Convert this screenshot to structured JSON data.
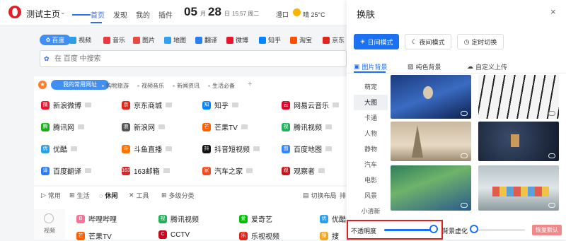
{
  "header": {
    "site_title": "测试主页",
    "nav": [
      "首页",
      "发现",
      "我的",
      "插件"
    ],
    "month": "05",
    "month_unit": "月",
    "day": "28",
    "day_unit": "日",
    "time_weekday": "15:57 周二",
    "city": "澧口",
    "weather": "晴 25°C"
  },
  "search": {
    "engines": [
      {
        "label": "百度",
        "color": "#3f8ff5"
      },
      {
        "label": "视频",
        "color": "#2b9fe8"
      },
      {
        "label": "音乐",
        "color": "#e8393f"
      },
      {
        "label": "图片",
        "color": "#e84a3f"
      },
      {
        "label": "地图",
        "color": "#31a0ee"
      },
      {
        "label": "翻译",
        "color": "#2b7df3"
      },
      {
        "label": "微博",
        "color": "#e6162d"
      },
      {
        "label": "知乎",
        "color": "#0084ff"
      },
      {
        "label": "淘宝",
        "color": "#ff5000"
      },
      {
        "label": "京东",
        "color": "#e1251b"
      }
    ],
    "placeholder": "在 百度 中搜索"
  },
  "links": {
    "tab_active": "我的常用网址",
    "categories": [
      "购物旅游",
      "视频音乐",
      "新闻资讯",
      "生活必备"
    ],
    "add": "+",
    "sites": [
      {
        "name": "新浪微博",
        "color": "#e6162d",
        "short": "微"
      },
      {
        "name": "京东商城",
        "color": "#e1251b",
        "short": "京"
      },
      {
        "name": "知乎",
        "color": "#0084ff",
        "short": "知"
      },
      {
        "name": "网易云音乐",
        "color": "#e60026",
        "short": "云"
      },
      {
        "name": "腾讯网",
        "color": "#1aad19",
        "short": "腾"
      },
      {
        "name": "新浪网",
        "color": "#555555",
        "short": "浪"
      },
      {
        "name": "芒果TV",
        "color": "#ff5f00",
        "short": "芒"
      },
      {
        "name": "腾讯视频",
        "color": "#20b15a",
        "short": "视"
      },
      {
        "name": "优酷",
        "color": "#2b9fe8",
        "short": "优"
      },
      {
        "name": "斗鱼直播",
        "color": "#ff7300",
        "short": "斗"
      },
      {
        "name": "抖音短视频",
        "color": "#111111",
        "short": "抖"
      },
      {
        "name": "百度地图",
        "color": "#3385ff",
        "short": "图"
      },
      {
        "name": "百度翻译",
        "color": "#2b7df3",
        "short": "译"
      },
      {
        "name": "163邮箱",
        "color": "#d8232a",
        "short": "163"
      },
      {
        "name": "汽车之家",
        "color": "#f24a1a",
        "short": "家"
      },
      {
        "name": "观察者",
        "color": "#c4161c",
        "short": "观"
      }
    ]
  },
  "bottom": {
    "tabs": [
      "常用",
      "生活",
      "休闲",
      "工具",
      "多级分类"
    ],
    "switch_layout": "切换布局",
    "more": "排",
    "side_label": "视频",
    "sites": [
      {
        "name": "哔哩哔哩",
        "color": "#fb7299",
        "short": "B"
      },
      {
        "name": "腾讯视频",
        "color": "#20b15a",
        "short": "视"
      },
      {
        "name": "爱奇艺",
        "color": "#00be06",
        "short": "爱"
      },
      {
        "name": "优酷",
        "color": "#2b9fe8",
        "short": "优"
      },
      {
        "name": "芒果TV",
        "color": "#ff5f00",
        "short": "芒"
      },
      {
        "name": "CCTV",
        "color": "#d0021b",
        "short": "C"
      },
      {
        "name": "乐视视频",
        "color": "#e1251b",
        "short": "乐"
      },
      {
        "name": "搜",
        "color": "#f5a623",
        "short": "搜"
      }
    ]
  },
  "skin": {
    "title": "换肤",
    "close": "×",
    "modes": [
      "日间模式",
      "夜间模式",
      "定时切换"
    ],
    "tabs": [
      "图片背景",
      "纯色背景",
      "自定义上传"
    ],
    "categories": [
      "萌宠",
      "大图",
      "卡通",
      "人物",
      "静物",
      "汽车",
      "电影",
      "风景",
      "小清新"
    ],
    "active_category": "大图",
    "opacity_label": "不透明度",
    "opacity_value": 0.95,
    "blur_label": "背景虚化",
    "blur_value": 0.0,
    "reset": "恢复默认"
  }
}
